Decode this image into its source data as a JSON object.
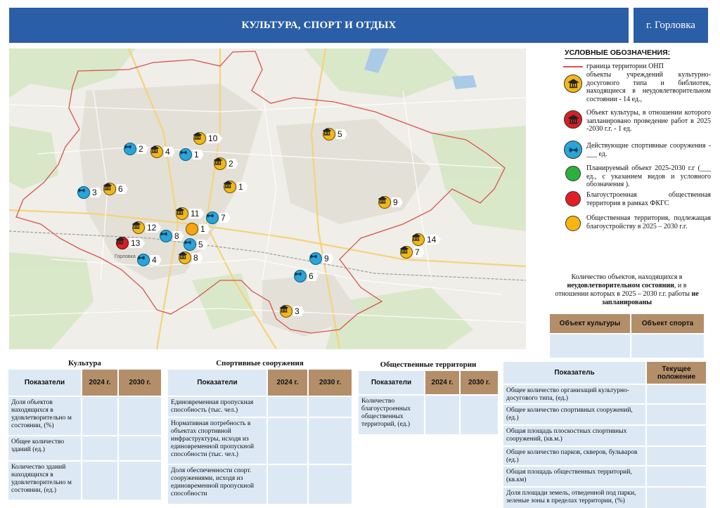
{
  "header": {
    "title": "КУЛЬТУРА, СПОРТ И ОТДЫХ",
    "city": "г. Горловка"
  },
  "colors": {
    "header_bg": "#2a5ea6",
    "culture": "#f2b819",
    "culture_alert": "#d71f26",
    "sport": "#2aa4d9",
    "planned": "#2bb03c",
    "park_done": "#e21f26",
    "park_planned": "#f6b510",
    "boundary": "#d9534f",
    "table_head": "#b38e69",
    "table_cell": "#dce9f5"
  },
  "map": {
    "label_town": "Горловка",
    "markers": [
      {
        "kind": "culture",
        "num": "10"
      },
      {
        "kind": "culture",
        "num": "4"
      },
      {
        "kind": "sport",
        "num": "2"
      },
      {
        "kind": "sport",
        "num": "1"
      },
      {
        "kind": "culture",
        "num": "2"
      },
      {
        "kind": "culture",
        "num": "1"
      },
      {
        "kind": "culture",
        "num": "5"
      },
      {
        "kind": "sport",
        "num": "3"
      },
      {
        "kind": "culture",
        "num": "6"
      },
      {
        "kind": "culture",
        "num": "11"
      },
      {
        "kind": "sport",
        "num": "7"
      },
      {
        "kind": "culture",
        "num": "12"
      },
      {
        "kind": "orange",
        "num": "1"
      },
      {
        "kind": "sport",
        "num": "8"
      },
      {
        "kind": "red",
        "num": "13"
      },
      {
        "kind": "sport",
        "num": "5"
      },
      {
        "kind": "sport",
        "num": "4"
      },
      {
        "kind": "culture",
        "num": "8"
      },
      {
        "kind": "culture",
        "num": "9"
      },
      {
        "kind": "culture",
        "num": "14"
      },
      {
        "kind": "culture",
        "num": "7"
      },
      {
        "kind": "sport",
        "num": "9"
      },
      {
        "kind": "sport",
        "num": "6"
      },
      {
        "kind": "culture",
        "num": "3"
      }
    ]
  },
  "legend": {
    "title": "УСЛОВНЫЕ ОБОЗНАЧЕНИЯ:",
    "items": [
      {
        "symbol": "boundary-line",
        "text": "граница территории ОНП"
      },
      {
        "symbol": "culture",
        "text": "объекты учреждений культурно-досугового типа и библиотек, находящиеся в неудовлетворительном состоянии - 14 ед.,"
      },
      {
        "symbol": "culture-red",
        "text": "Объект культуры, в отношении которого запланировано проведение работ в 2025 -2030 г.г. - 1 ед."
      },
      {
        "symbol": "sport",
        "text": "Действующие спортивные сооружения - ___ ед."
      },
      {
        "symbol": "green",
        "text": "Планируемый объект 2025-2030 г.г (___ ед., с указанием видов и условного обозначения )."
      },
      {
        "symbol": "red",
        "text": "Благоустроенная общественная территория в рамках ФКГС"
      },
      {
        "symbol": "orange",
        "text": "Общественная территория, подлежащая благоустройству в 2025 – 2030 г.г."
      }
    ]
  },
  "info": {
    "text_a": "Количество объектов, находящихся в",
    "text_b": "неудовлетворительном состоянии",
    "text_c": ", и в отношении которых в 2025 – 2030 г.г. работы",
    "text_d": "не запланированы",
    "col1": "Объект культуры",
    "col2": "Объект спорта"
  },
  "culture_table": {
    "title": "Культура",
    "header": [
      "Показатели",
      "2024 г.",
      "2030 г."
    ],
    "rows": [
      "Доля объектов находящихся в удовлетворительно м состоянии, (%)",
      "Общее количество зданий (ед.)",
      "Количество зданий находящихся в удовлетворительно м состоянии, (ед.)"
    ]
  },
  "sport_table": {
    "title": "Спортивные сооружения",
    "header": [
      "Показатели",
      "2024 г.",
      "2030 г."
    ],
    "rows": [
      "Единовременная пропускная способность (тыс. чел.)",
      "Нормативная потребность в объектах спортивной инфраструктуры, исходя из единовременной пропускной способности (тыс. чел.)",
      "Доля обеспеченности спорт. сооружениями, исходя из единовременной пропускной способности"
    ]
  },
  "public_table": {
    "title": "Общественные территории",
    "header": [
      "Показатели",
      "2024 г.",
      "2030 г."
    ],
    "rows": [
      "Количество благоустроенных общественных территорий, (ед.)"
    ]
  },
  "status_table": {
    "header": [
      "Показатель",
      "Текущее положение"
    ],
    "rows": [
      "Общее количество организаций культурно-досугового типа, (ед.)",
      "Общее количество спортивных сооружений, (ед.)",
      "Общая площадь плоскостных спортивных сооружений, (кв.м.)",
      "Общее количество парков, скверов, бульваров (ед.)",
      "Общая площадь общественных территорий, (кв.км)",
      "Доля площади земель, отведенной под парки, зеленые зоны в пределах территории, (%)"
    ]
  }
}
